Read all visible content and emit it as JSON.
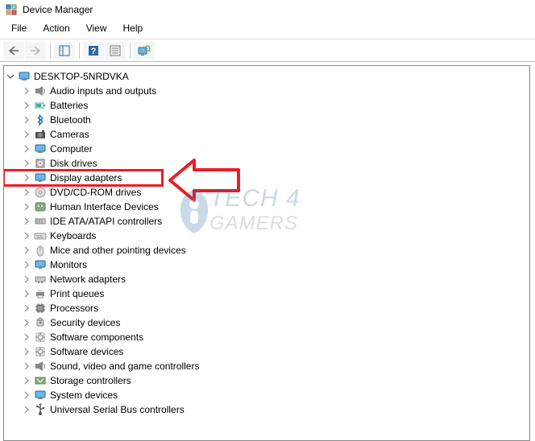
{
  "window": {
    "title": "Device Manager"
  },
  "menu": {
    "file": "File",
    "action": "Action",
    "view": "View",
    "help": "Help"
  },
  "tree": {
    "root": "DESKTOP-5NRDVKA",
    "items": [
      {
        "label": "Audio inputs and outputs",
        "icon": "speaker"
      },
      {
        "label": "Batteries",
        "icon": "battery"
      },
      {
        "label": "Bluetooth",
        "icon": "bluetooth"
      },
      {
        "label": "Cameras",
        "icon": "camera"
      },
      {
        "label": "Computer",
        "icon": "computer"
      },
      {
        "label": "Disk drives",
        "icon": "disk"
      },
      {
        "label": "Display adapters",
        "icon": "display"
      },
      {
        "label": "DVD/CD-ROM drives",
        "icon": "cdrom"
      },
      {
        "label": "Human Interface Devices",
        "icon": "hid"
      },
      {
        "label": "IDE ATA/ATAPI controllers",
        "icon": "ide"
      },
      {
        "label": "Keyboards",
        "icon": "keyboard"
      },
      {
        "label": "Mice and other pointing devices",
        "icon": "mouse"
      },
      {
        "label": "Monitors",
        "icon": "monitor"
      },
      {
        "label": "Network adapters",
        "icon": "network"
      },
      {
        "label": "Print queues",
        "icon": "printer"
      },
      {
        "label": "Processors",
        "icon": "cpu"
      },
      {
        "label": "Security devices",
        "icon": "security"
      },
      {
        "label": "Software components",
        "icon": "software"
      },
      {
        "label": "Software devices",
        "icon": "software"
      },
      {
        "label": "Sound, video and game controllers",
        "icon": "sound"
      },
      {
        "label": "Storage controllers",
        "icon": "storage"
      },
      {
        "label": "System devices",
        "icon": "system"
      },
      {
        "label": "Universal Serial Bus controllers",
        "icon": "usb"
      }
    ]
  },
  "watermark": {
    "line1": "TECH 4",
    "line2": "GAMERS"
  },
  "annotation": {
    "highlighted_index": 6,
    "color": "#ec1c24"
  }
}
